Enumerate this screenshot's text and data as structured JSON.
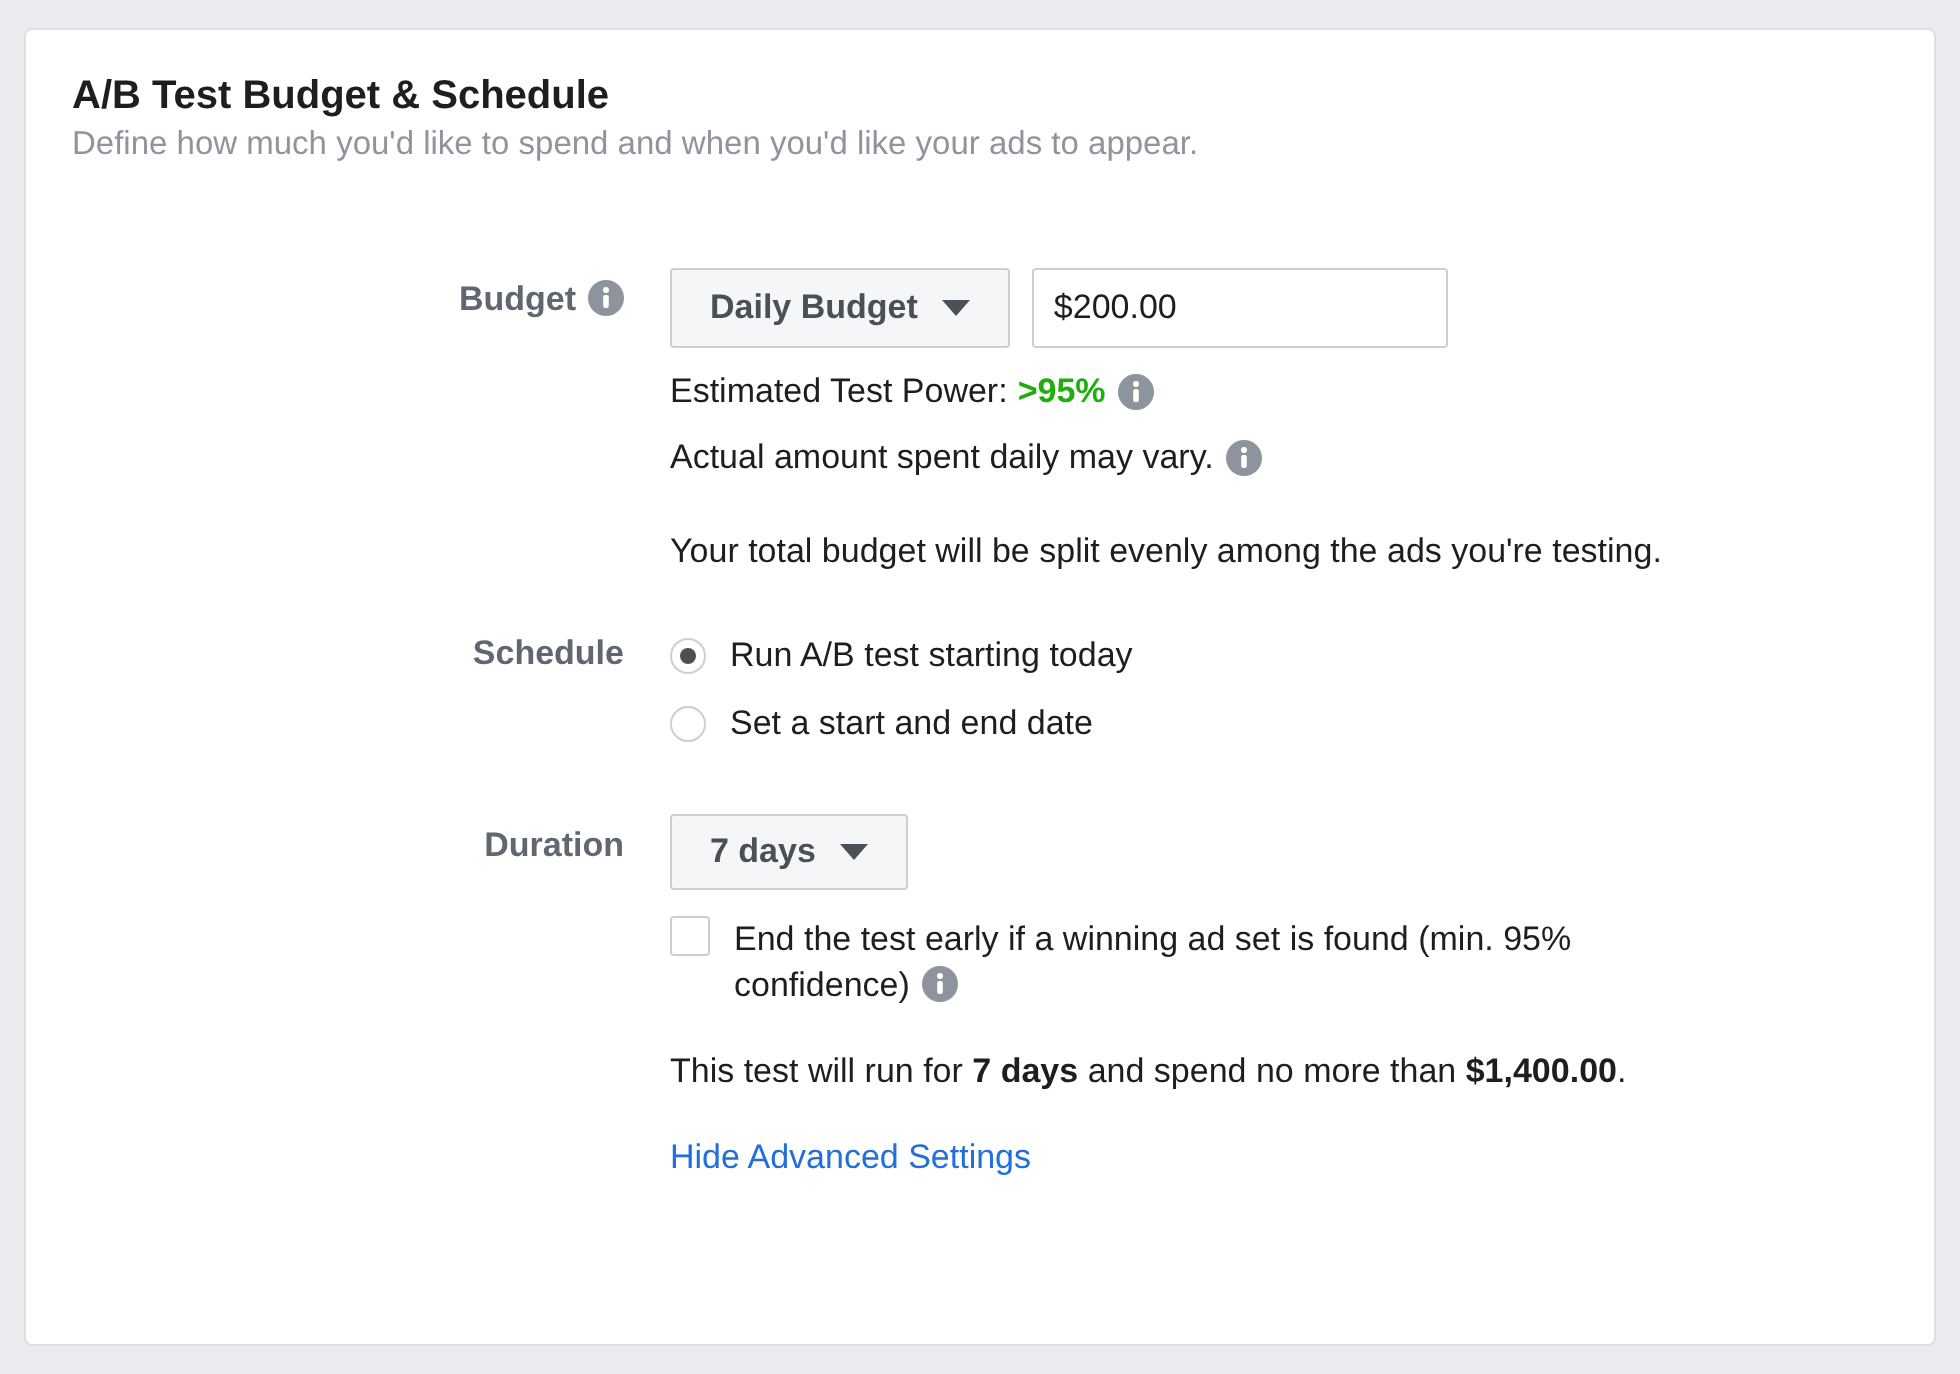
{
  "title": "A/B Test Budget & Schedule",
  "subtitle": "Define how much you'd like to spend and when you'd like your ads to appear.",
  "budget": {
    "label": "Budget",
    "type_dropdown": "Daily Budget",
    "amount": "$200.00",
    "power_label": "Estimated Test Power:",
    "power_value": ">95%",
    "vary_note": "Actual amount spent daily may vary.",
    "split_note": "Your total budget will be split evenly among the ads you're testing."
  },
  "schedule": {
    "label": "Schedule",
    "options": [
      {
        "label": "Run A/B test starting today",
        "selected": true
      },
      {
        "label": "Set a start and end date",
        "selected": false
      }
    ]
  },
  "duration": {
    "label": "Duration",
    "dropdown": "7 days",
    "end_early": {
      "label": "End the test early if a winning ad set is found (min. 95% confidence)",
      "checked": false
    },
    "summary": "This test will run for **7 days** and spend no more than **$1,400.00**."
  },
  "link": "Hide Advanced Settings"
}
